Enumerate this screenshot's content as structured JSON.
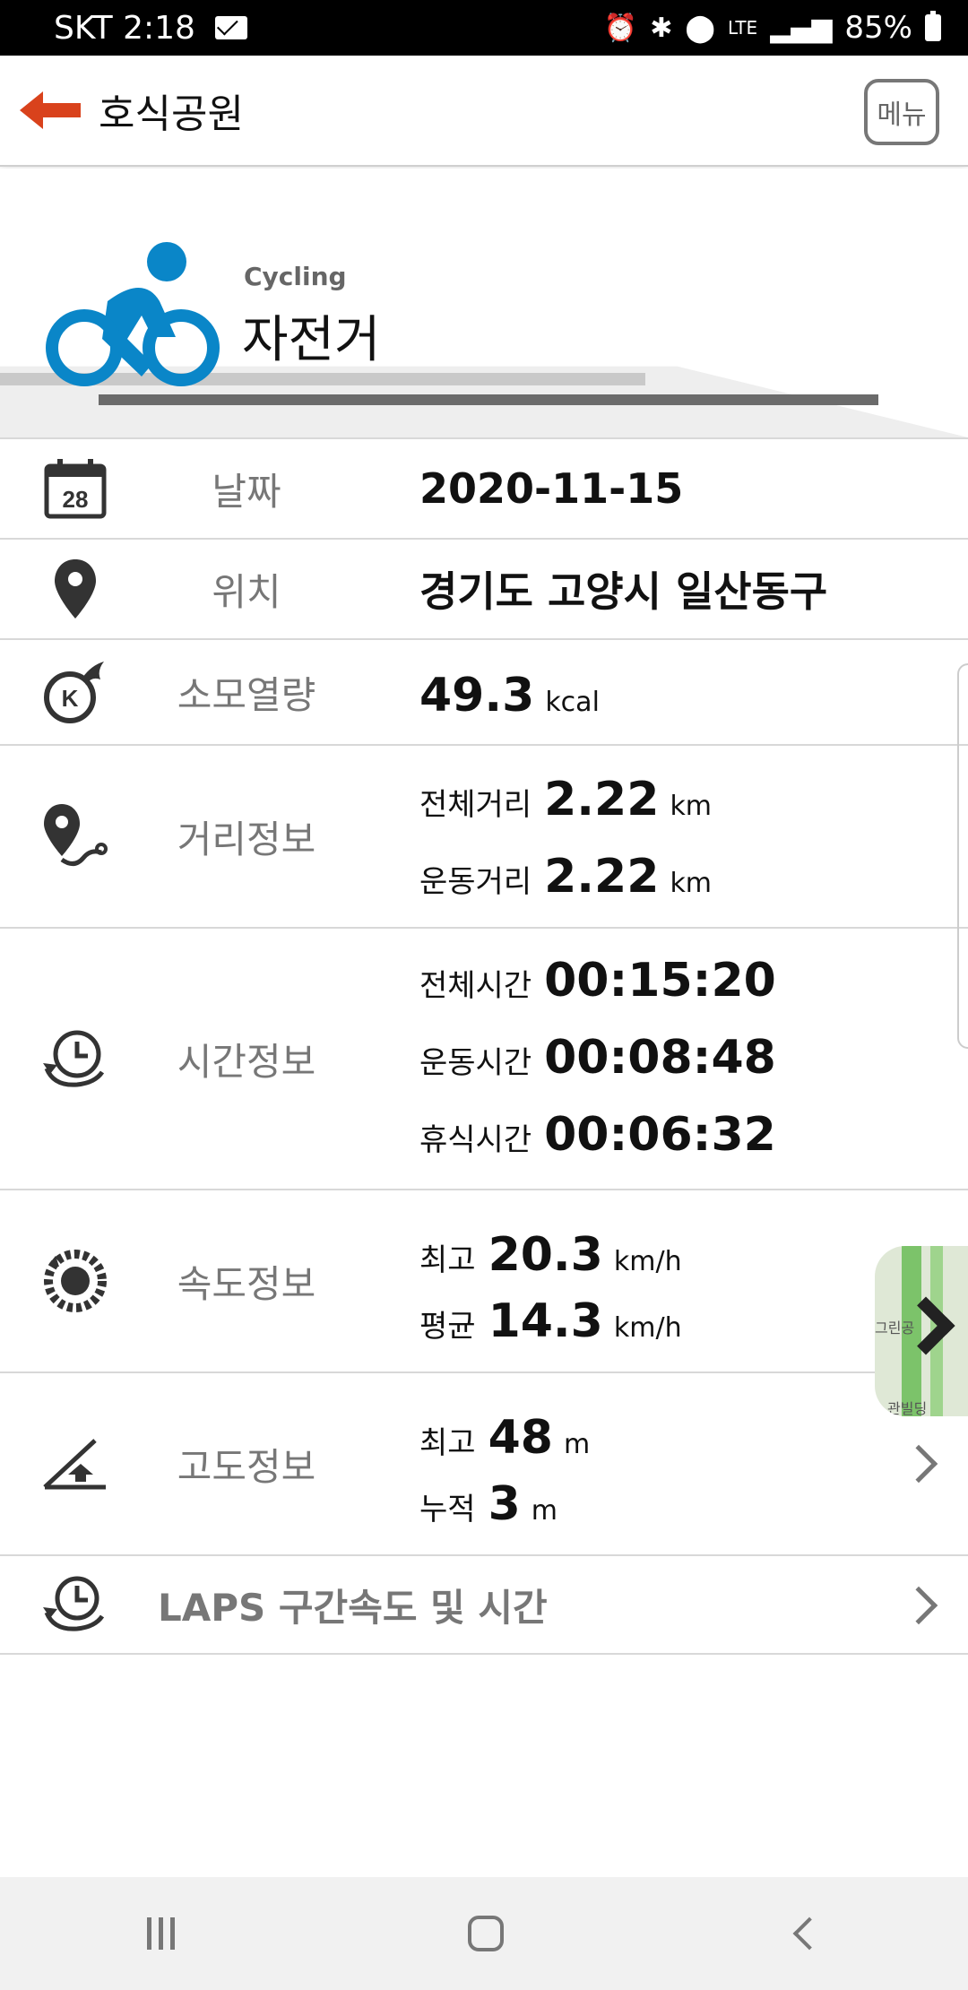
{
  "status": {
    "carrier_time": "SKT 2:18",
    "network": "LTE",
    "battery": "85%"
  },
  "header": {
    "title": "호식공원",
    "menu_label": "메뉴"
  },
  "activity": {
    "sub": "Cycling",
    "name": "자전거"
  },
  "rows": {
    "date": {
      "label": "날짜",
      "value": "2020-11-15"
    },
    "location": {
      "label": "위치",
      "value": "경기도 고양시 일산동구"
    },
    "calories": {
      "label": "소모열량",
      "value": "49.3",
      "unit": "kcal"
    },
    "distance": {
      "label": "거리정보",
      "total_key": "전체거리",
      "total_value": "2.22",
      "total_unit": "km",
      "moving_key": "운동거리",
      "moving_value": "2.22",
      "moving_unit": "km"
    },
    "time": {
      "label": "시간정보",
      "total_key": "전체시간",
      "total_value": "00:15:20",
      "moving_key": "운동시간",
      "moving_value": "00:08:48",
      "rest_key": "휴식시간",
      "rest_value": "00:06:32"
    },
    "speed": {
      "label": "속도정보",
      "max_key": "최고",
      "max_value": "20.3",
      "max_unit": "km/h",
      "avg_key": "평균",
      "avg_value": "14.3",
      "avg_unit": "km/h"
    },
    "altitude": {
      "label": "고도정보",
      "max_key": "최고",
      "max_value": "48",
      "max_unit": "m",
      "acc_key": "누적",
      "acc_value": "3",
      "acc_unit": "m"
    },
    "laps": {
      "label": "LAPS 구간속도 및 시간"
    }
  },
  "map_tile": {
    "label_top": "그린공",
    "label_bottom": "관빌딩"
  },
  "colors": {
    "accent": "#d9421c",
    "brand_blue": "#0a86c8"
  }
}
